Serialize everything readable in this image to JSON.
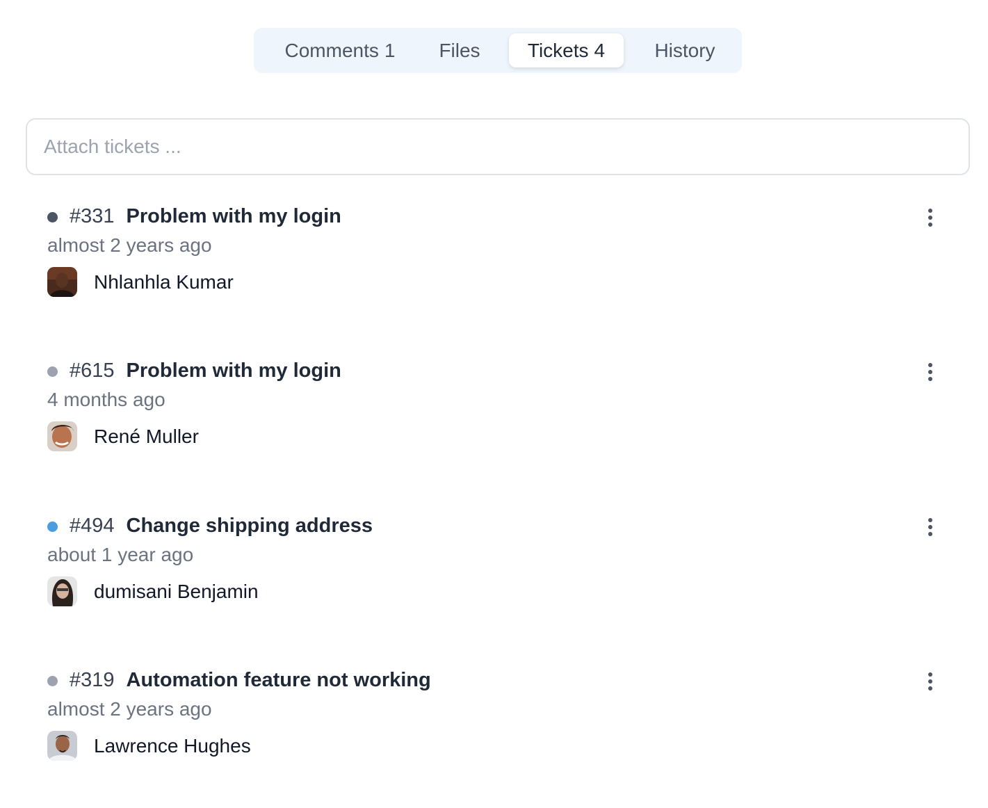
{
  "tabs": [
    {
      "label": "Comments",
      "count": "1"
    },
    {
      "label": "Files",
      "count": ""
    },
    {
      "label": "Tickets",
      "count": "4"
    },
    {
      "label": "History",
      "count": ""
    }
  ],
  "active_tab": "Tickets",
  "attach": {
    "placeholder": "Attach tickets ..."
  },
  "status_colors": {
    "dark": "#4b5563",
    "gray": "#9ca3af",
    "blue": "#4a9ee0"
  },
  "tickets": [
    {
      "number": "#331",
      "title": "Problem with my login",
      "time": "almost 2 years ago",
      "assignee": "Nhlanhla Kumar",
      "status_color": "#4b5563",
      "menu_icon": "more-vertical-icon"
    },
    {
      "number": "#615",
      "title": "Problem with my login",
      "time": "4 months ago",
      "assignee": "René Muller",
      "status_color": "#9ca3af",
      "menu_icon": "more-vertical-icon"
    },
    {
      "number": "#494",
      "title": "Change shipping address",
      "time": "about 1 year ago",
      "assignee": "dumisani Benjamin",
      "status_color": "#4a9ee0",
      "menu_icon": "more-vertical-icon"
    },
    {
      "number": "#319",
      "title": "Automation feature not working",
      "time": "almost 2 years ago",
      "assignee": "Lawrence Hughes",
      "status_color": "#9ca3af",
      "menu_icon": "more-vertical-icon"
    }
  ]
}
